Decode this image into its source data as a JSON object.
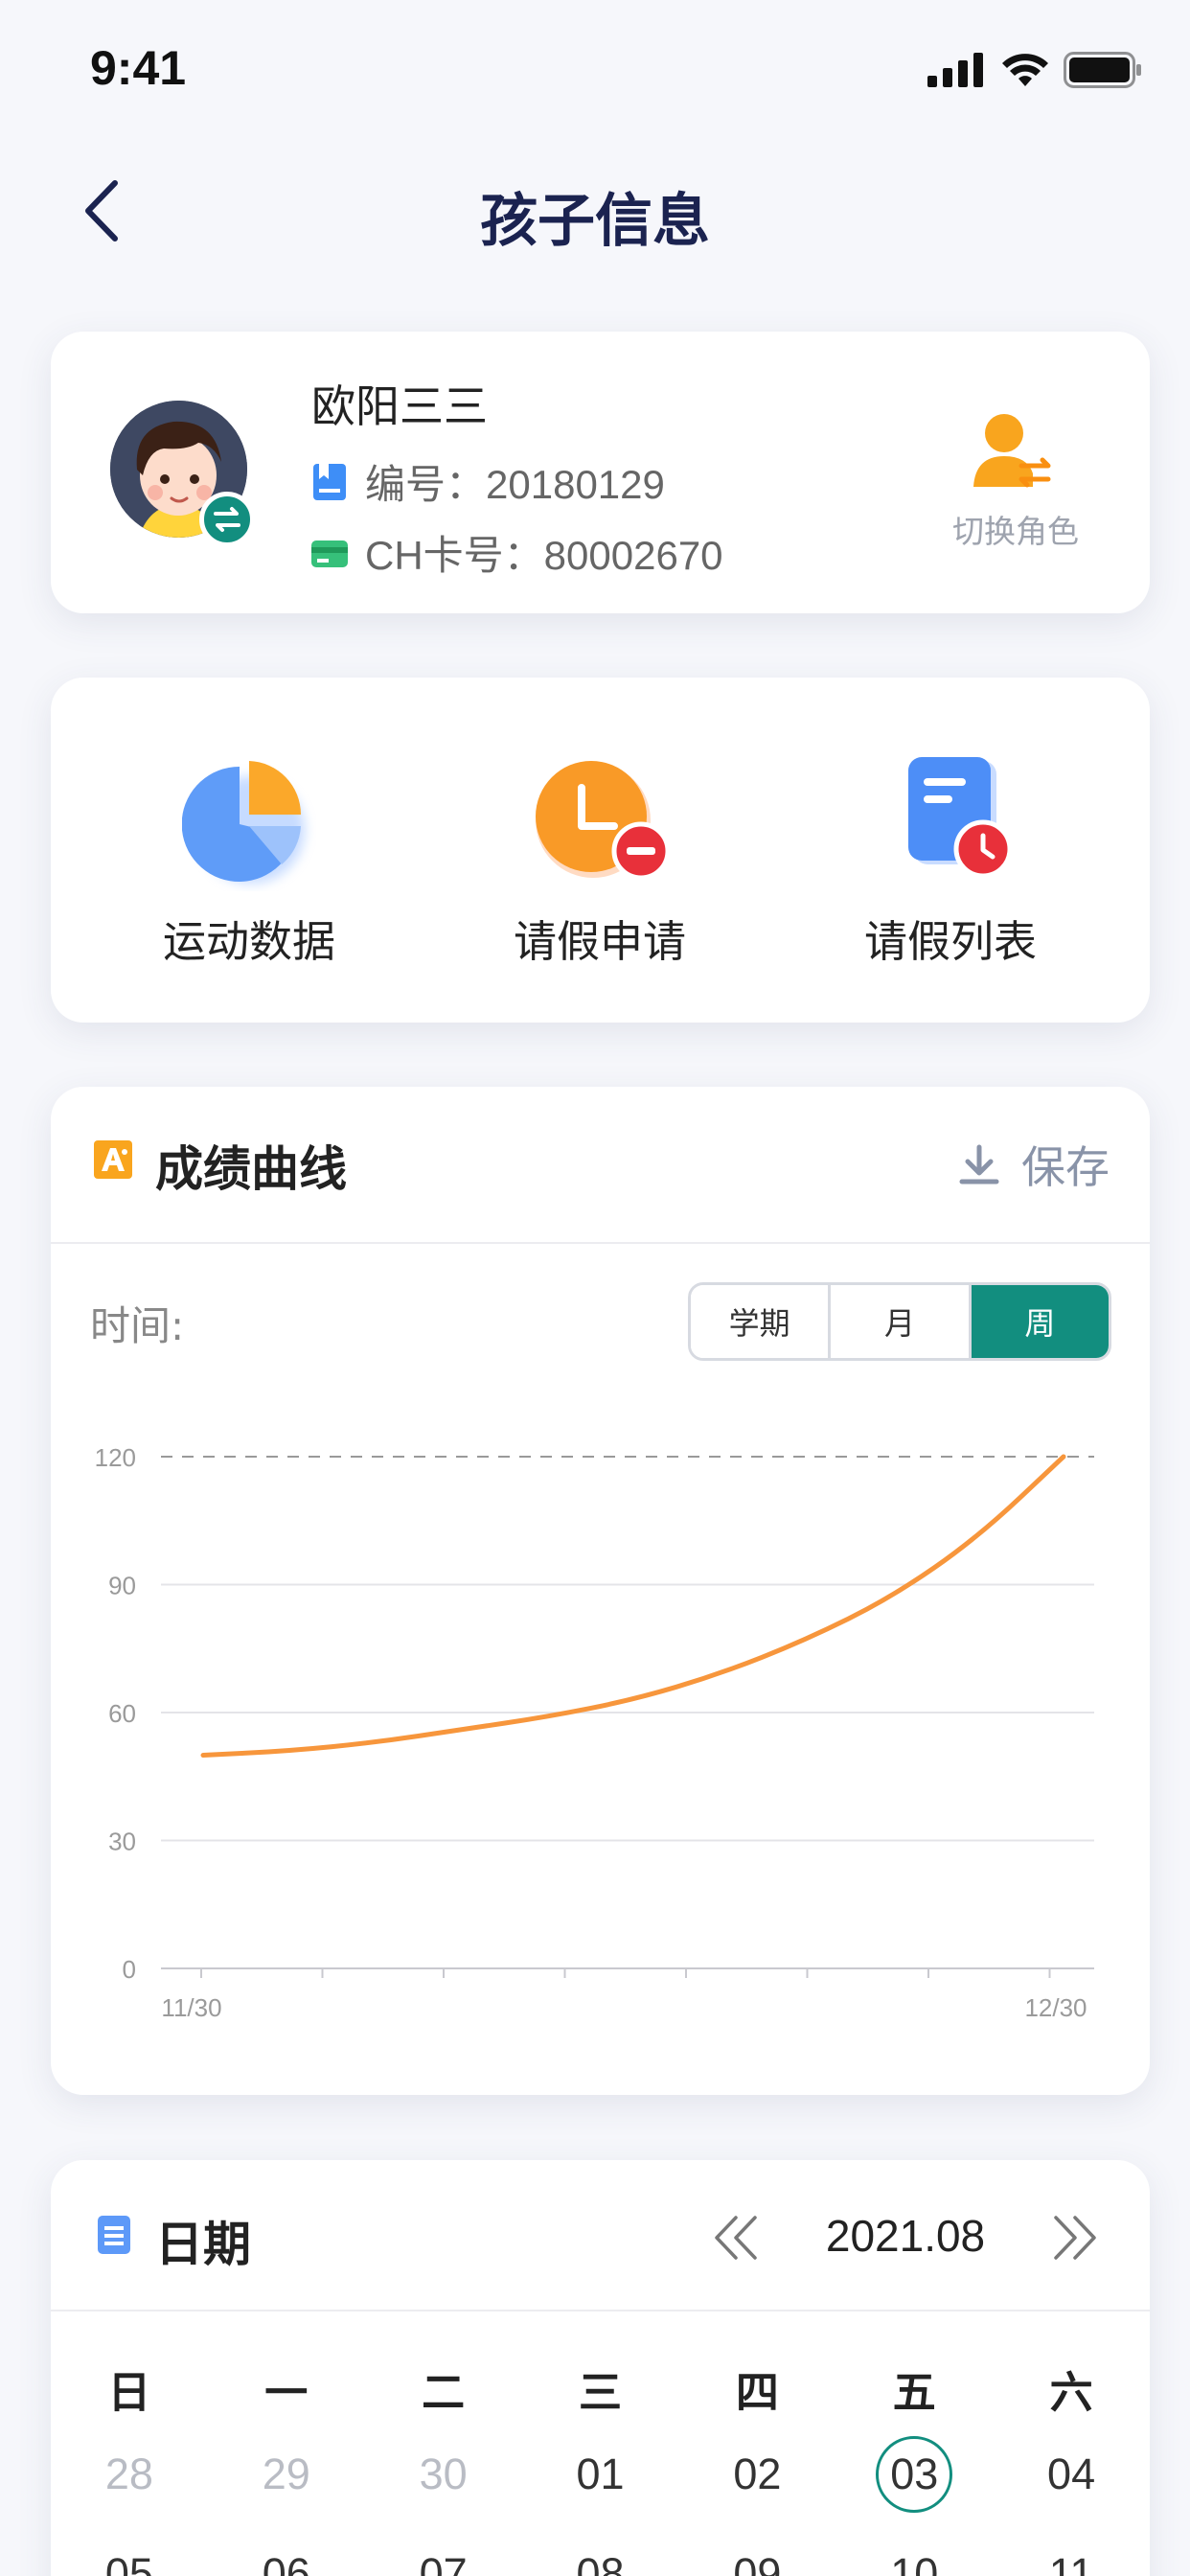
{
  "status": {
    "time": "9:41"
  },
  "header": {
    "title": "孩子信息"
  },
  "child": {
    "name": "欧阳三三",
    "id_label": "编号：",
    "id_value": "20180129",
    "card_label": "CH卡号：",
    "card_value": "80002670",
    "switch_label": "切换角色"
  },
  "functions": [
    {
      "label": "运动数据",
      "icon": "pie-chart-icon"
    },
    {
      "label": "请假申请",
      "icon": "clock-minus-icon"
    },
    {
      "label": "请假列表",
      "icon": "list-clock-icon"
    }
  ],
  "score": {
    "title": "成绩曲线",
    "save_label": "保存",
    "time_label": "时间:",
    "segments": [
      "学期",
      "月",
      "周"
    ],
    "selected_segment": "周"
  },
  "chart_data": {
    "type": "line",
    "x_ticks": [
      "11/30",
      "12/30"
    ],
    "y_ticks": [
      0,
      30,
      60,
      90,
      120
    ],
    "ylim": [
      0,
      120
    ],
    "reference_line": 120,
    "grid": true,
    "series": [
      {
        "color": "#f7963c",
        "x": [
          0,
          0.1,
          0.2,
          0.3,
          0.4,
          0.5,
          0.6,
          0.7,
          0.8,
          0.9,
          1.0
        ],
        "y": [
          50,
          51,
          53,
          56,
          59,
          63,
          69,
          77,
          87,
          101,
          120
        ]
      }
    ]
  },
  "calendar": {
    "title": "日期",
    "month": "2021.08",
    "weekdays": [
      "日",
      "一",
      "二",
      "三",
      "四",
      "五",
      "六"
    ],
    "week1": [
      "28",
      "29",
      "30",
      "01",
      "02",
      "03",
      "04"
    ],
    "week1_muted": [
      true,
      true,
      true,
      false,
      false,
      false,
      false
    ],
    "today": "03",
    "week2": [
      "05",
      "06",
      "07",
      "08",
      "09",
      "10",
      "11"
    ]
  },
  "colors": {
    "accent": "#128e7f",
    "title": "#1b2350",
    "line": "#f7963c"
  }
}
